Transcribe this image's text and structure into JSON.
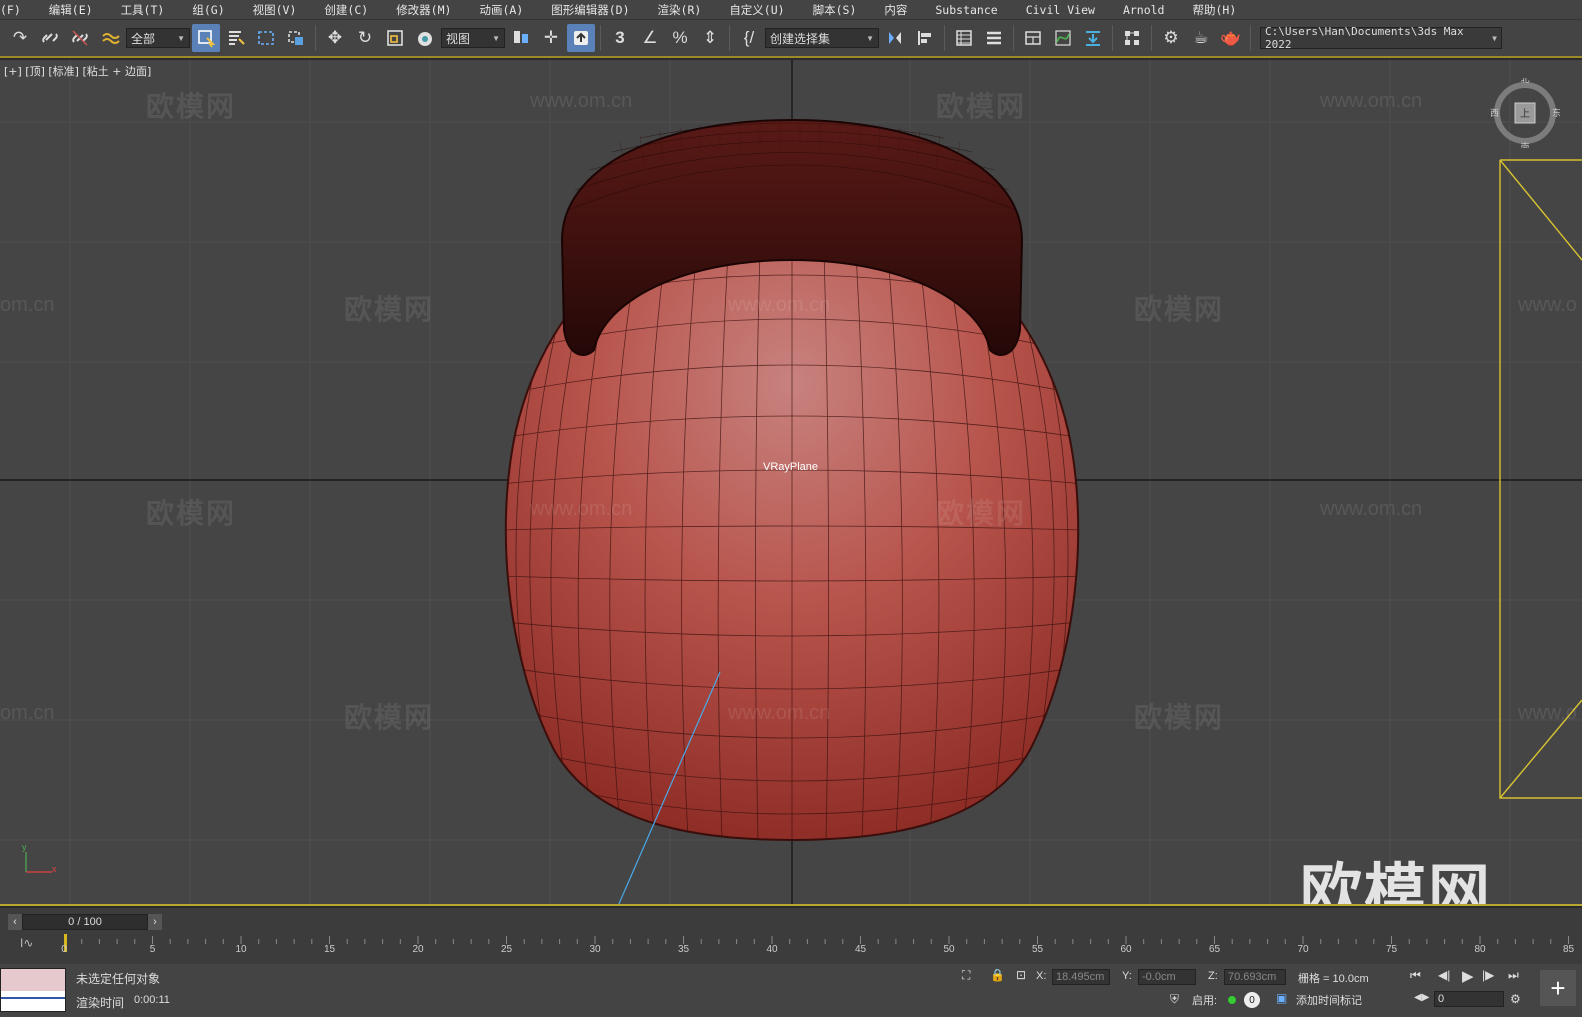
{
  "menu": [
    "(F)",
    "编辑(E)",
    "工具(T)",
    "组(G)",
    "视图(V)",
    "创建(C)",
    "修改器(M)",
    "动画(A)",
    "图形编辑器(D)",
    "渲染(R)",
    "自定义(U)",
    "脚本(S)",
    "内容",
    "Substance",
    "Civil View",
    "Arnold",
    "帮助(H)"
  ],
  "toolbar": {
    "selection_filter": "全部",
    "ref_coord": "视图",
    "named_selection": "创建选择集",
    "project_path": "C:\\Users\\Han\\Documents\\3ds Max 2022"
  },
  "viewport": {
    "label": "[+] [顶] [标准] [粘土 + 边面]",
    "object_label": "VRayPlane",
    "watermark": "欧模网",
    "watermark_url": "www.om.cn",
    "watermark_url_partial": "om.cn",
    "watermark_url_cut": "www.o",
    "brand_watermark": "欧模网",
    "viewcube": {
      "n": "北",
      "s": "南",
      "w": "西",
      "e": "东",
      "face": "上"
    },
    "axis": {
      "x": "x",
      "y": "y"
    }
  },
  "timeline": {
    "frame_display": "0 / 100",
    "ticks": [
      "0",
      "5",
      "10",
      "15",
      "20",
      "25",
      "30",
      "35",
      "40",
      "45",
      "50",
      "55",
      "60",
      "65",
      "70",
      "75",
      "80",
      "85"
    ]
  },
  "status": {
    "selection": "未选定任何对象",
    "render_time_label": "渲染时间",
    "render_time": "0:00:11",
    "x_label": "X:",
    "x_value": "18.495cm",
    "y_label": "Y:",
    "y_value": "-0.0cm",
    "z_label": "Z:",
    "z_value": "70.693cm",
    "grid_label": "栅格 = 10.0cm",
    "enable_label": "启用:",
    "enable_count": "0",
    "add_time_tag": "添加时间标记",
    "current_frame": "0"
  },
  "colors": {
    "viewport_bg": "#454545",
    "chair_seat": "#b8564e",
    "chair_back": "#3a0f0c",
    "selection_yellow": "#d7c232",
    "active_button": "#5b82b8"
  }
}
